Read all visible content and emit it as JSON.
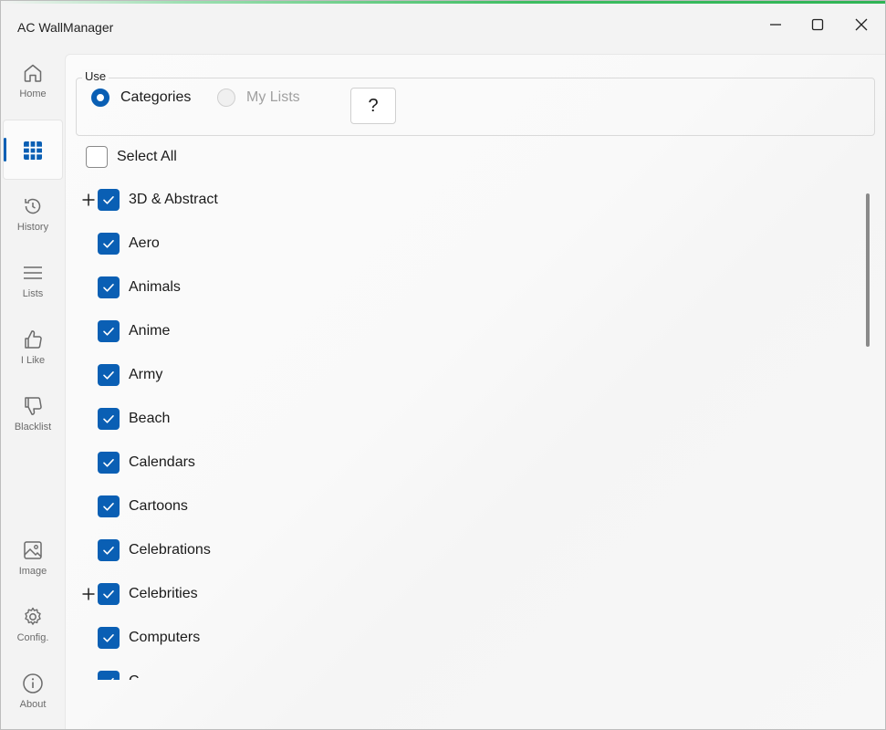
{
  "window": {
    "title": "AC WallManager",
    "accent_color": "#0a5fb4"
  },
  "sidebar": {
    "items": [
      {
        "label": "Home",
        "icon": "home-icon"
      },
      {
        "label": "",
        "icon": "grid-icon",
        "active": true
      },
      {
        "label": "History",
        "icon": "history-icon"
      },
      {
        "label": "Lists",
        "icon": "list-icon"
      },
      {
        "label": "I Like",
        "icon": "thumbs-up-icon"
      },
      {
        "label": "Blacklist",
        "icon": "thumbs-down-icon"
      },
      {
        "label": "Image",
        "icon": "image-icon"
      },
      {
        "label": "Config.",
        "icon": "gear-icon"
      },
      {
        "label": "About",
        "icon": "info-icon"
      }
    ]
  },
  "use_group": {
    "legend": "Use",
    "options": [
      {
        "label": "Categories",
        "selected": true,
        "enabled": true
      },
      {
        "label": "My Lists",
        "selected": false,
        "enabled": false
      }
    ],
    "help_label": "?"
  },
  "select_all": {
    "label": "Select All",
    "checked": false
  },
  "categories": [
    {
      "label": "3D & Abstract",
      "checked": true,
      "expandable": true
    },
    {
      "label": "Aero",
      "checked": true,
      "expandable": false
    },
    {
      "label": "Animals",
      "checked": true,
      "expandable": false
    },
    {
      "label": "Anime",
      "checked": true,
      "expandable": false
    },
    {
      "label": "Army",
      "checked": true,
      "expandable": false
    },
    {
      "label": "Beach",
      "checked": true,
      "expandable": false
    },
    {
      "label": "Calendars",
      "checked": true,
      "expandable": false
    },
    {
      "label": "Cartoons",
      "checked": true,
      "expandable": false
    },
    {
      "label": "Celebrations",
      "checked": true,
      "expandable": false
    },
    {
      "label": "Celebrities",
      "checked": true,
      "expandable": true
    },
    {
      "label": "Computers",
      "checked": true,
      "expandable": false
    },
    {
      "label": "C",
      "checked": true,
      "expandable": false
    }
  ]
}
